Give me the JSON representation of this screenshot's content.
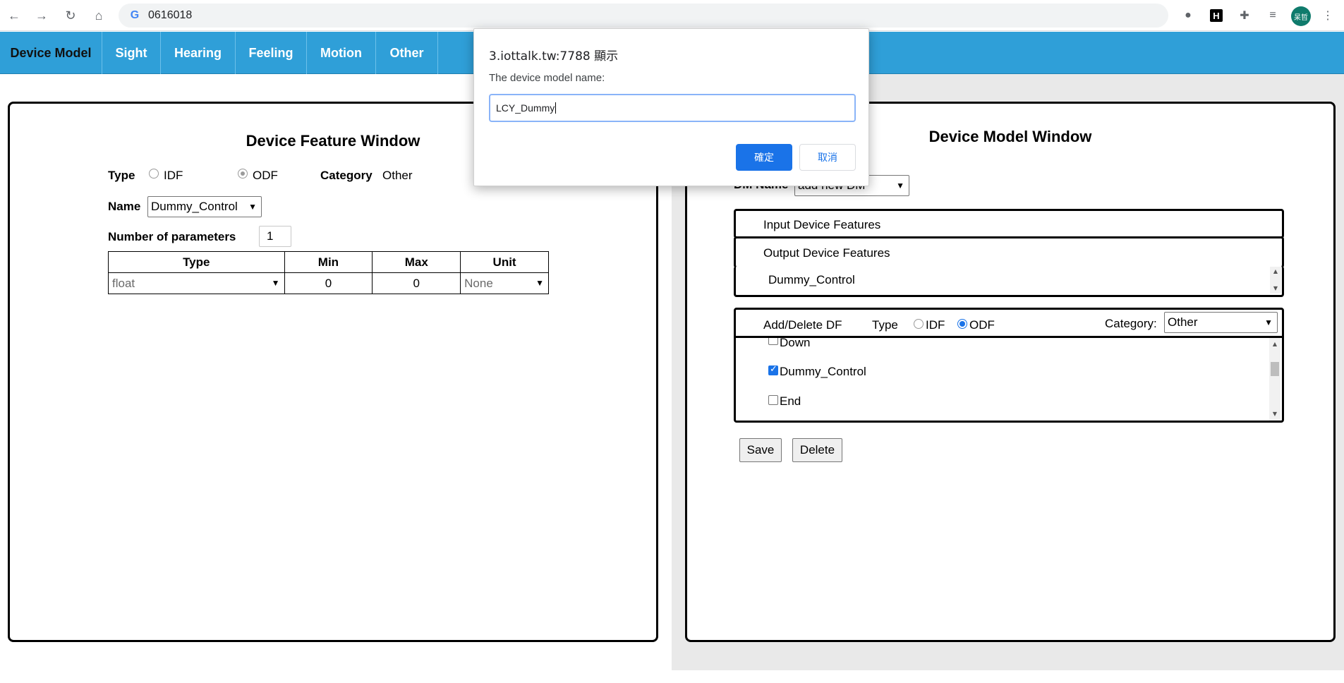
{
  "browser": {
    "url": "0616018",
    "avatar_text": "呆哲",
    "icons": [
      "back-icon",
      "forward-icon",
      "reload-icon",
      "home-icon",
      "google-icon",
      "cookie-icon",
      "h-extension-icon",
      "puzzle-extensions-icon",
      "media-control-icon",
      "menu-dots-icon"
    ]
  },
  "nav": {
    "items": [
      {
        "label": "Device Model"
      },
      {
        "label": "Sight"
      },
      {
        "label": "Hearing"
      },
      {
        "label": "Feeling"
      },
      {
        "label": "Motion"
      },
      {
        "label": "Other"
      }
    ],
    "color": "#2f9fd8"
  },
  "feature_window": {
    "title": "Device Feature Window",
    "type_label": "Type",
    "idf_label": "IDF",
    "odf_label": "ODF",
    "type_selected": "ODF",
    "category_label": "Category",
    "category_value": "Other",
    "name_label": "Name",
    "name_value": "Dummy_Control",
    "num_params_label": "Number of parameters",
    "num_params_value": "1",
    "table": {
      "headers": [
        "Type",
        "Min",
        "Max",
        "Unit"
      ],
      "rows": [
        {
          "type": "float",
          "min": "0",
          "max": "0",
          "unit": "None"
        }
      ]
    }
  },
  "model_window": {
    "title": "Device Model Window",
    "dm_name_label": "DM Name",
    "dm_name_value": "add new DM",
    "input_features_label": "Input Device Features",
    "output_features_label": "Output Device Features",
    "output_features": [
      "Dummy_Control"
    ],
    "add_delete_label": "Add/Delete DF",
    "type_label": "Type",
    "idf_label": "IDF",
    "odf_label": "ODF",
    "type_selected": "ODF",
    "category_label": "Category:",
    "category_value": "Other",
    "df_list": [
      {
        "label": "Down",
        "checked": false
      },
      {
        "label": "Dummy_Control",
        "checked": true
      },
      {
        "label": "End",
        "checked": false
      }
    ],
    "save_label": "Save",
    "delete_label": "Delete"
  },
  "dialog": {
    "title": "3.iottalk.tw:7788 顯示",
    "message": "The device model name:",
    "input_value": "LCY_Dummy",
    "ok_label": "確定",
    "cancel_label": "取消",
    "ok_color": "#1a73e8"
  }
}
